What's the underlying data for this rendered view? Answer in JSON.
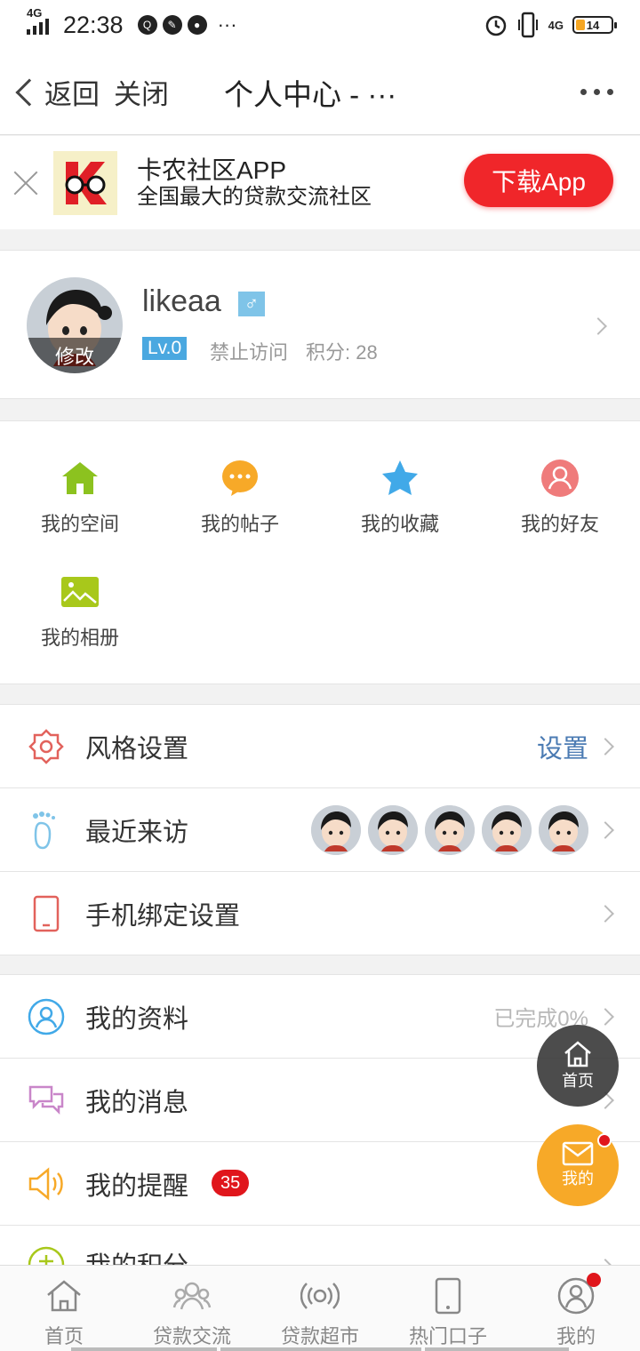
{
  "status_bar": {
    "network": "4G",
    "time": "22:38",
    "right_network": "4G",
    "battery": "14",
    "extra_icons": "···"
  },
  "nav": {
    "back_label": "返回",
    "close_label": "关闭",
    "title": "个人中心 - ···"
  },
  "banner": {
    "title": "卡农社区APP",
    "subtitle": "全国最大的贷款交流社区",
    "download_label": "下载App"
  },
  "profile": {
    "username": "likeaa",
    "gender_symbol": "♂",
    "avatar_edit_label": "修改",
    "level": "Lv.0",
    "status": "禁止访问",
    "points": "积分: 28"
  },
  "quick_links": [
    {
      "label": "我的空间",
      "icon": "home-icon",
      "color": "#8cc21f"
    },
    {
      "label": "我的帖子",
      "icon": "chat-bubble-icon",
      "color": "#f7a928"
    },
    {
      "label": "我的收藏",
      "icon": "star-icon",
      "color": "#41a9e8"
    },
    {
      "label": "我的好友",
      "icon": "friend-icon",
      "color": "#ef7b7b"
    },
    {
      "label": "我的相册",
      "icon": "album-icon",
      "color": "#a8c81b"
    }
  ],
  "settings_list": [
    {
      "label": "风格设置",
      "value": "设置",
      "icon": "style-gear-icon"
    },
    {
      "label": "最近来访",
      "icon": "footprint-icon"
    },
    {
      "label": "手机绑定设置",
      "icon": "phone-icon"
    }
  ],
  "personal_list": [
    {
      "label": "我的资料",
      "value": "已完成0%",
      "icon": "profile-icon"
    },
    {
      "label": "我的消息",
      "icon": "message-icon"
    },
    {
      "label": "我的提醒",
      "badge": "35",
      "icon": "speaker-icon"
    },
    {
      "label": "我的积分",
      "icon": "points-icon"
    }
  ],
  "fab": {
    "home_label": "首页",
    "mine_label": "我的"
  },
  "tabs": [
    {
      "label": "首页",
      "icon": "house-icon"
    },
    {
      "label": "贷款交流",
      "icon": "community-icon"
    },
    {
      "label": "贷款超市",
      "icon": "broadcast-icon"
    },
    {
      "label": "热门口子",
      "icon": "mobile-icon"
    },
    {
      "label": "我的",
      "icon": "user-icon"
    }
  ]
}
